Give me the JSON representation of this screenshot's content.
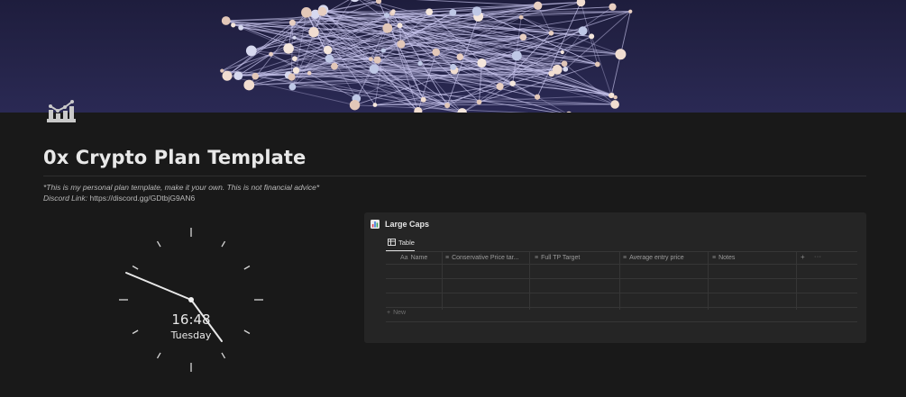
{
  "page": {
    "title": "0x Crypto Plan Template",
    "disclaimer": "*This is my personal plan template, make it your own. This is not financial advice*",
    "discord_label": "Discord Link:",
    "discord_url": "https://discord.gg/GDtbjG9AN6"
  },
  "icons": {
    "page_icon": "chart-icon",
    "cover": "network-sphere-cover"
  },
  "clock": {
    "time": "16:48",
    "day": "Tuesday"
  },
  "database": {
    "title": "Large Caps",
    "view_tab": "Table",
    "columns": [
      {
        "icon": "Aa",
        "label": "Name"
      },
      {
        "icon": "≡",
        "label": "Conservative Price tar..."
      },
      {
        "icon": "≡",
        "label": "Full TP Target"
      },
      {
        "icon": "≡",
        "label": "Average entry price"
      },
      {
        "icon": "≡",
        "label": "Notes"
      }
    ],
    "add_column": "+",
    "more": "···",
    "new_row": "New",
    "new_row_icon": "+"
  },
  "colors": {
    "background": "#191919",
    "cover_dark": "#1e1d3d",
    "database_bg": "#252525",
    "text": "#d4d4d4"
  }
}
